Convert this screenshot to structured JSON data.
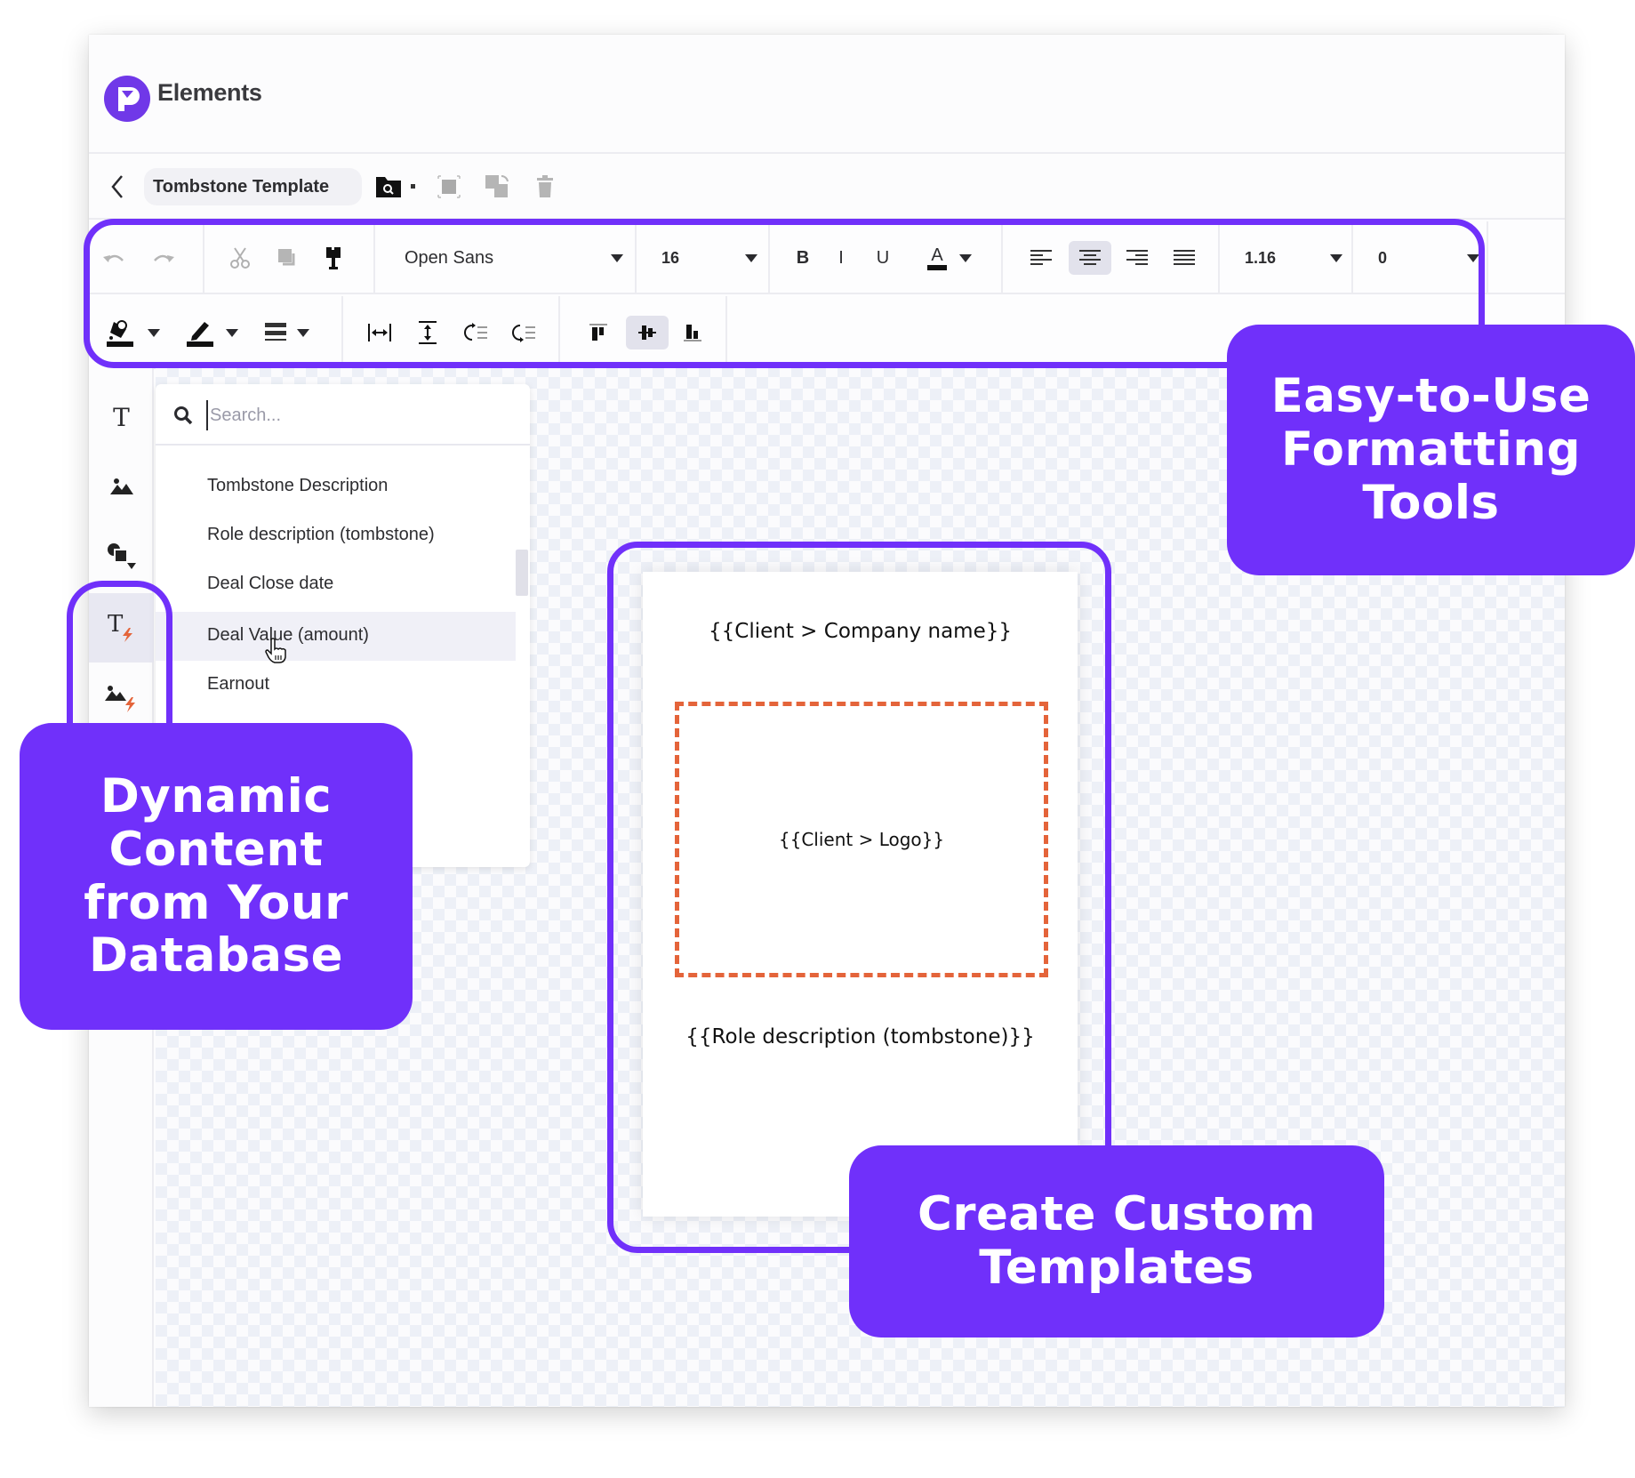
{
  "app": {
    "title": "Elements",
    "brand_color": "#7038e8",
    "accent_color": "#7030fa"
  },
  "doc_bar": {
    "document_name": "Tombstone Template",
    "icons": [
      "back-chevron-icon",
      "folder-search-icon",
      "dot-separator",
      "select-frame-icon",
      "duplicate-icon",
      "trash-icon"
    ]
  },
  "toolbar": {
    "font_family": "Open Sans",
    "font_size": "16",
    "bold_label": "B",
    "italic_label": "I",
    "underline_label": "U",
    "text_color_label": "A",
    "line_height": "1.16",
    "letter_spacing": "0",
    "active_text_align": "center",
    "active_vertical_align": "middle"
  },
  "dynamic_panel": {
    "search_placeholder": "Search...",
    "items": [
      {
        "label": "Tombstone Description"
      },
      {
        "label": "Role description (tombstone)"
      },
      {
        "label": "Deal Close date"
      },
      {
        "label": "Deal Value (amount)"
      },
      {
        "label": "Earnout"
      }
    ],
    "hovered_item": "Deal Value (amount)"
  },
  "template": {
    "company_field": "{{Client > Company name}}",
    "logo_field": "{{Client > Logo}}",
    "role_field": "{{Role description (tombstone)}}",
    "logo_border_color": "#e4643a"
  },
  "callouts": {
    "formatting": "Easy-to-Use Formatting Tools",
    "dynamic": "Dynamic Content from Your Database",
    "templates": "Create Custom Templates"
  }
}
